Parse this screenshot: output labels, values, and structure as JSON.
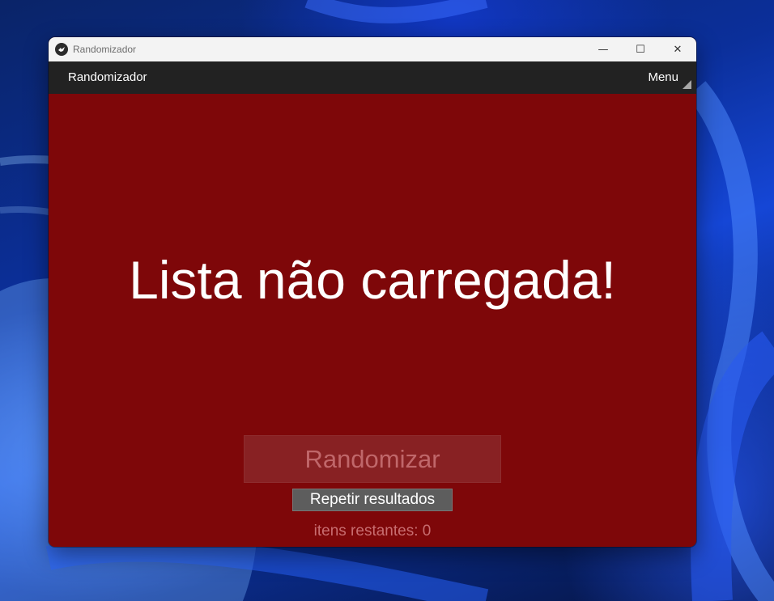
{
  "window": {
    "title": "Randomizador",
    "controls": {
      "minimize": "—",
      "maximize": "☐",
      "close": "✕"
    }
  },
  "actionbar": {
    "title": "Randomizador",
    "menu_label": "Menu"
  },
  "main": {
    "message": "Lista não carregada!",
    "randomize_label": "Randomizar",
    "repeat_label": "Repetir resultados",
    "remaining_text": "itens restantes: 0"
  },
  "colors": {
    "background": "#7e0709",
    "actionbar": "#222222",
    "titlebar": "#f3f3f3",
    "button_disabled_text": "#c0676a",
    "repeat_button": "#5d5d5d"
  }
}
